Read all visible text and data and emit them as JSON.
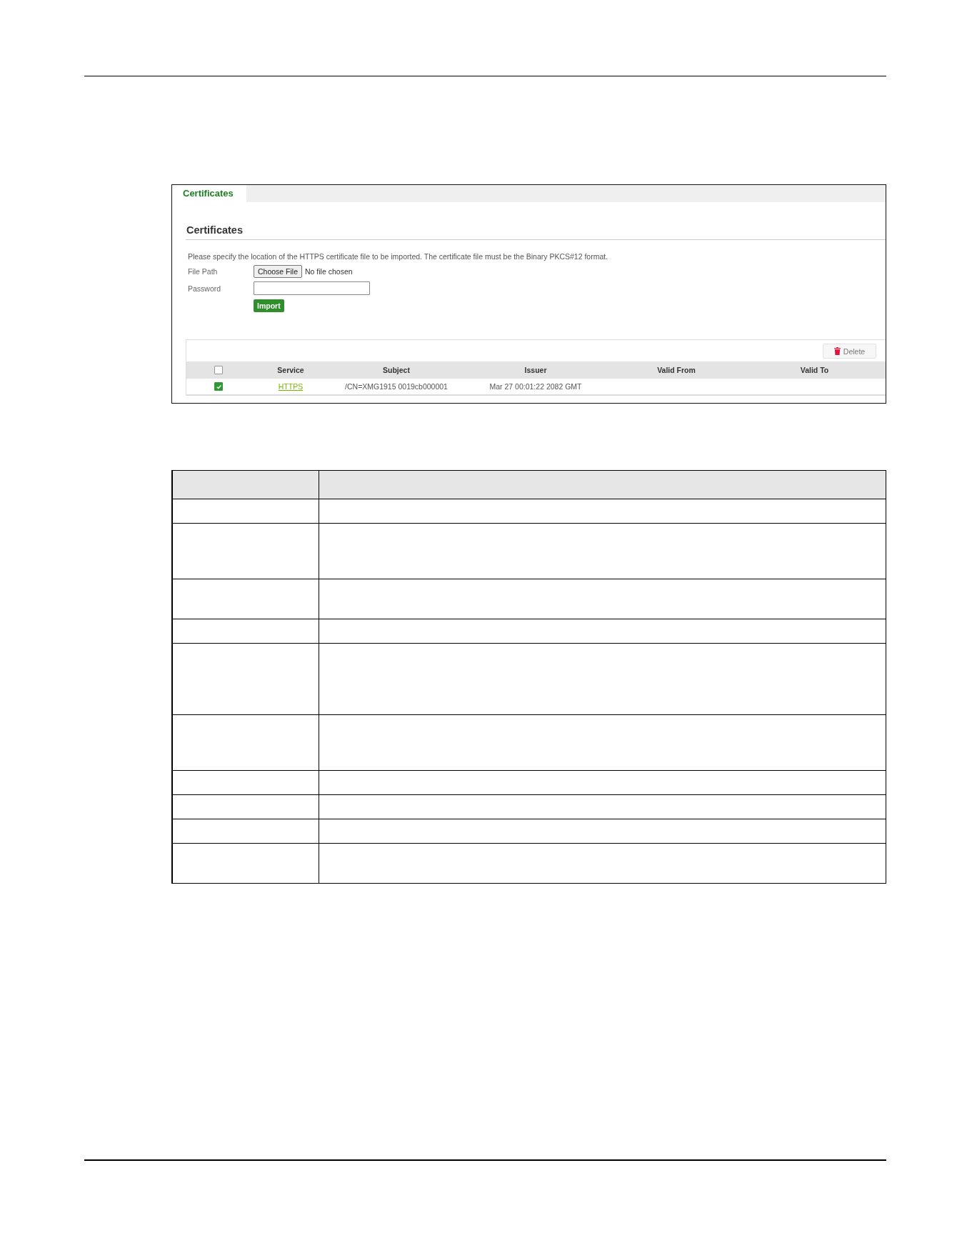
{
  "certificates_screen": {
    "tabs": [
      {
        "label": "Certificates",
        "selected": true
      }
    ],
    "section_title": "Certificates",
    "instructions": "Please specify the location of the HTTPS certificate file to be imported. The certificate file must be the Binary PKCS#12 format.",
    "file_path": {
      "label": "File Path",
      "button": "Choose File",
      "status": "No file chosen"
    },
    "password": {
      "label": "Password"
    },
    "import_button": "Import",
    "delete_button": "Delete",
    "table": {
      "header_checkbox": {
        "checked": false
      },
      "columns": [
        "Service",
        "Subject",
        "Issuer",
        "Valid From",
        "Valid To"
      ],
      "rows": [
        {
          "checked": true,
          "cells": [
            "HTTPS",
            "/CN=XMG1915 0019cb000001",
            "Mar 27 00:01:22 2082 GMT"
          ]
        }
      ]
    }
  },
  "field_table": {
    "rows": [
      {
        "kind": "one_line"
      },
      {
        "kind": "three_lines"
      },
      {
        "kind": "two_lines"
      },
      {
        "kind": "one_line"
      },
      {
        "kind": "four_lines"
      },
      {
        "kind": "three_lines"
      },
      {
        "kind": "one_line"
      },
      {
        "kind": "one_line"
      },
      {
        "kind": "one_line"
      },
      {
        "kind": "two_lines"
      }
    ]
  }
}
